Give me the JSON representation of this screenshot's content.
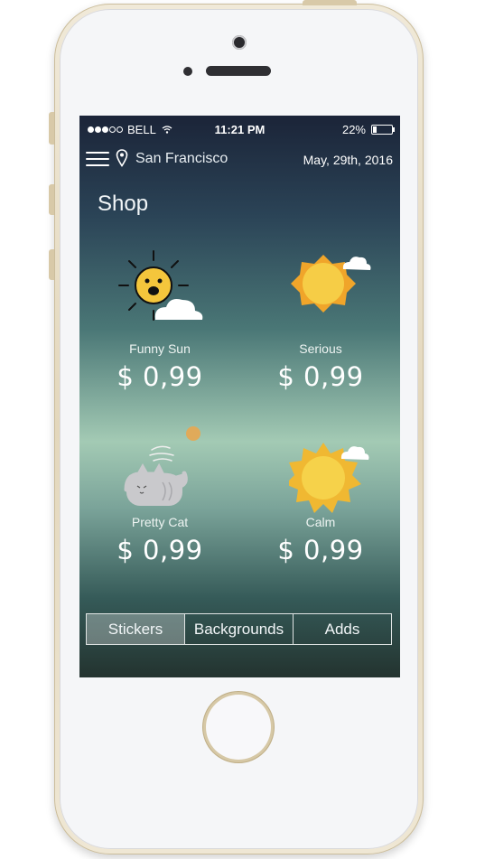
{
  "status_bar": {
    "carrier": "BELL",
    "time": "11:21 PM",
    "battery": "22%",
    "battery_level": 0.22,
    "signal_bars": 3
  },
  "nav": {
    "menu_icon": "hamburger-menu-icon",
    "location_icon": "location-pin-icon",
    "city": "San Francisco",
    "date": "May, 29th, 2016"
  },
  "page": {
    "title": "Shop"
  },
  "items": [
    {
      "name": "Funny Sun",
      "price": "$ 0,99",
      "icon": "funny-sun-sticker-icon"
    },
    {
      "name": "Serious",
      "price": "$ 0,99",
      "icon": "serious-sun-sticker-icon"
    },
    {
      "name": "Pretty Cat",
      "price": "$ 0,99",
      "icon": "pretty-cat-sticker-icon"
    },
    {
      "name": "Calm",
      "price": "$ 0,99",
      "icon": "calm-sun-sticker-icon"
    }
  ],
  "tabs": [
    {
      "label": "Stickers",
      "active": true
    },
    {
      "label": "Backgrounds",
      "active": false
    },
    {
      "label": "Adds",
      "active": false
    }
  ],
  "colors": {
    "sun_yellow": "#f4c63c",
    "sun_orange": "#f0a52a",
    "cloud": "#ffffff",
    "cat_gray": "#c9c9cc"
  }
}
